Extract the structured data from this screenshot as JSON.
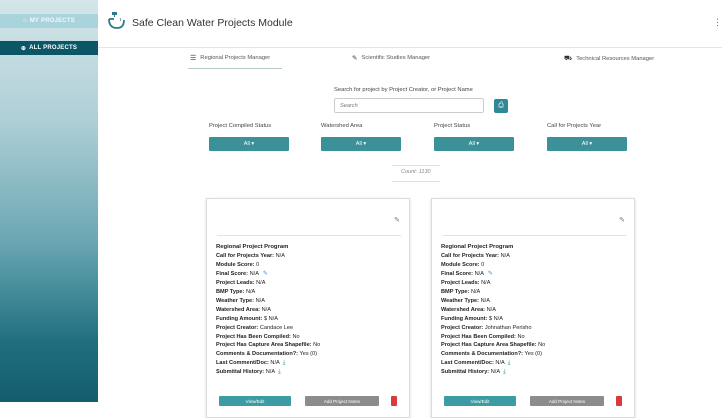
{
  "sidebar": {
    "my_projects": "MY PROJECTS",
    "all_projects": "ALL PROJECTS"
  },
  "header": {
    "title": "Safe Clean Water Projects Module",
    "menu_icon": "vertical-dots-icon"
  },
  "tabs": [
    {
      "label": "Regional Projects Manager",
      "icon": "list-icon"
    },
    {
      "label": "Scientific Studies Manager",
      "icon": "flask-icon"
    },
    {
      "label": "Technical Resources Manager",
      "icon": "tools-icon"
    }
  ],
  "search": {
    "label": "Search for project by Project Creator, or Project Name",
    "placeholder": "Search"
  },
  "filters": [
    {
      "label": "Project Compiled Status",
      "value": "All ▾"
    },
    {
      "label": "Watershed Area",
      "value": "All ▾"
    },
    {
      "label": "Project Status",
      "value": "All ▾"
    },
    {
      "label": "Call for Projects Year",
      "value": "All ▾"
    }
  ],
  "count": "Count: 1130",
  "cards": [
    {
      "program": "Regional Project Program",
      "call_year_label": "Call for Projects Year:",
      "call_year": "N/A",
      "module_score_label": "Module Score:",
      "module_score": "0",
      "final_score_label": "Final Score:",
      "final_score": "N/A",
      "leads_label": "Project Leads:",
      "leads": "N/A",
      "bmp_label": "BMP Type:",
      "bmp": "N/A",
      "weather_label": "Weather Type:",
      "weather": "N/A",
      "watershed_label": "Watershed Area:",
      "watershed": "N/A",
      "funding_label": "Funding Amount:",
      "funding": "$ N/A",
      "creator_label": "Project Creator:",
      "creator": "Candace Lee",
      "compiled_label": "Project Has Been Compiled:",
      "compiled": "No",
      "shapefile_label": "Project Has Capture Area Shapefile:",
      "shapefile": "No",
      "comments_label": "Comments & Documentation?:",
      "comments": "Yes (0)",
      "last_comment_label": "Last Comment/Doc:",
      "last_comment": "N/A",
      "history_label": "Submittal History:",
      "history": "N/A",
      "view_label": "View/Edit",
      "add_label": "Add Project Notes"
    },
    {
      "program": "Regional Project Program",
      "call_year_label": "Call for Projects Year:",
      "call_year": "N/A",
      "module_score_label": "Module Score:",
      "module_score": "0",
      "final_score_label": "Final Score:",
      "final_score": "N/A",
      "leads_label": "Project Leads:",
      "leads": "N/A",
      "bmp_label": "BMP Type:",
      "bmp": "N/A",
      "weather_label": "Weather Type:",
      "weather": "N/A",
      "watershed_label": "Watershed Area:",
      "watershed": "N/A",
      "funding_label": "Funding Amount:",
      "funding": "$ N/A",
      "creator_label": "Project Creator:",
      "creator": "Johnathan Perisho",
      "compiled_label": "Project Has Been Compiled:",
      "compiled": "No",
      "shapefile_label": "Project Has Capture Area Shapefile:",
      "shapefile": "No",
      "comments_label": "Comments & Documentation?:",
      "comments": "Yes (0)",
      "last_comment_label": "Last Comment/Doc:",
      "last_comment": "N/A",
      "history_label": "Submittal History:",
      "history": "N/A",
      "view_label": "View/Edit",
      "add_label": "Add Project Notes"
    }
  ],
  "colors": {
    "accent": "#3c9199",
    "sidebar_active": "#0b5766",
    "delete": "#d93a3a"
  }
}
